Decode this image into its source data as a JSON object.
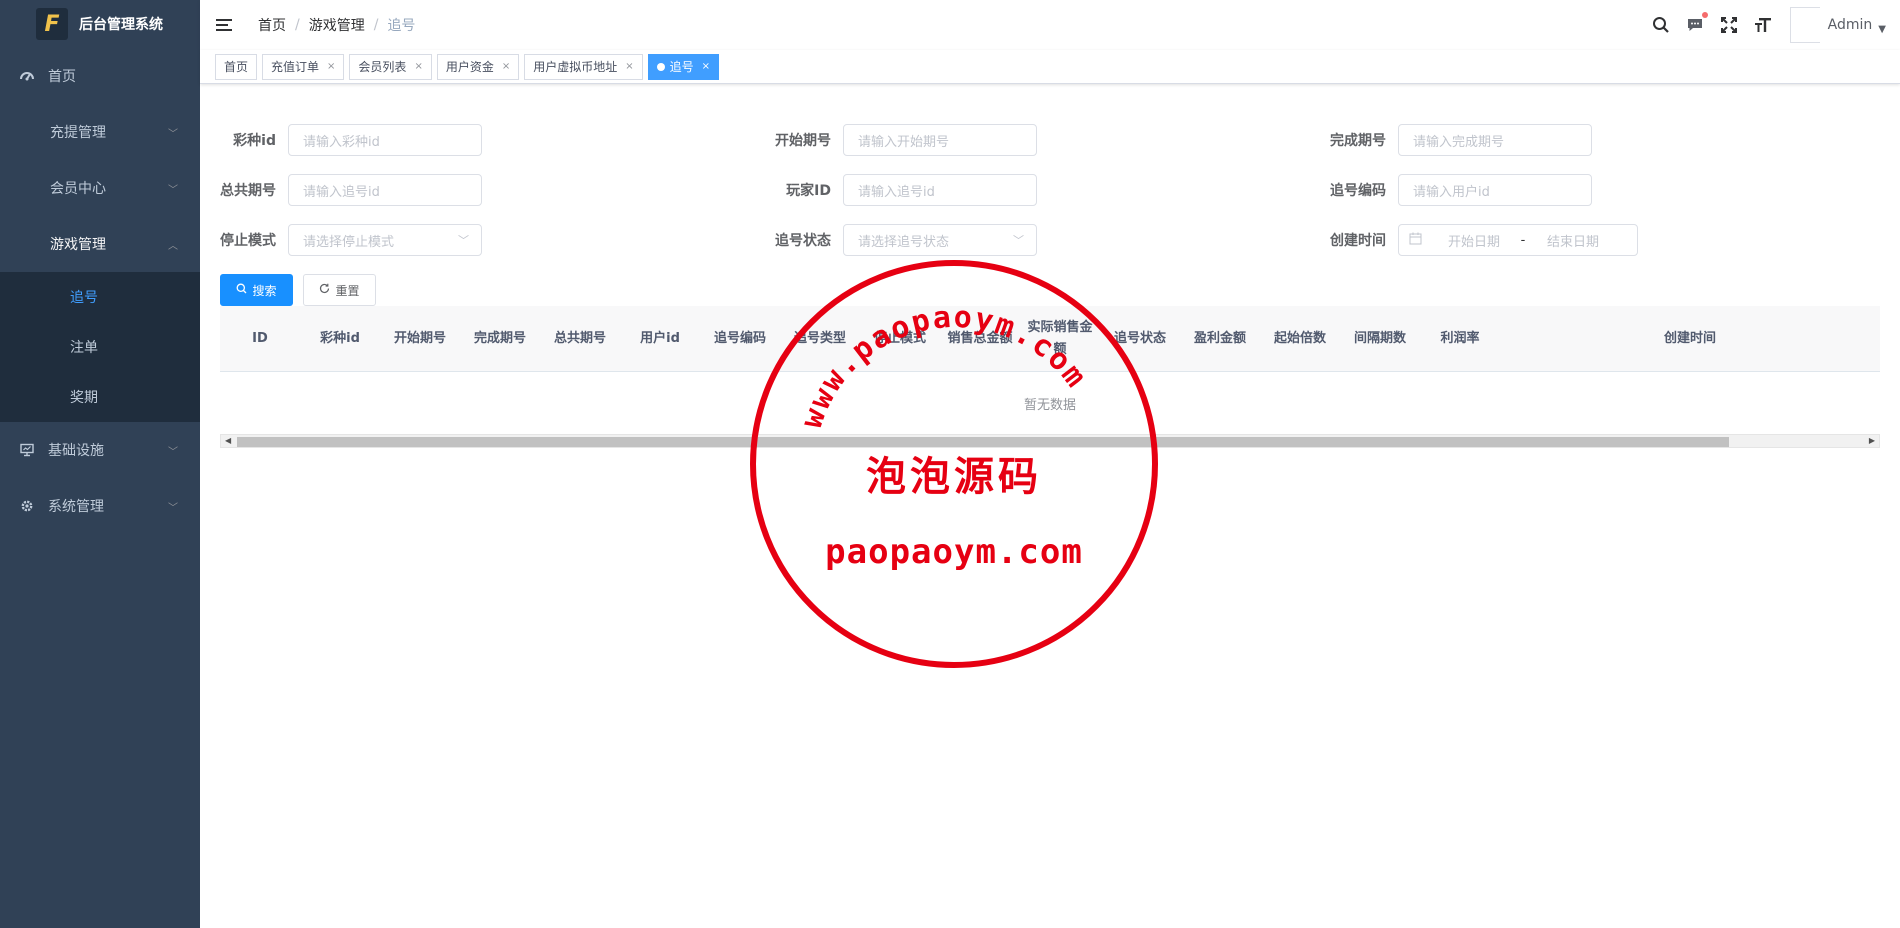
{
  "app": {
    "title": "后台管理系统",
    "logo_text": "F"
  },
  "sidebar": {
    "items": [
      {
        "label": "首页",
        "icon": "dashboard-icon"
      },
      {
        "label": "充提管理",
        "icon": ""
      },
      {
        "label": "会员中心",
        "icon": ""
      },
      {
        "label": "游戏管理",
        "icon": "",
        "open": true,
        "children": [
          {
            "label": "追号",
            "active": true
          },
          {
            "label": "注单"
          },
          {
            "label": "奖期"
          }
        ]
      },
      {
        "label": "基础设施",
        "icon": "monitor-icon"
      },
      {
        "label": "系统管理",
        "icon": "gear-icon"
      }
    ]
  },
  "navbar": {
    "breadcrumb": [
      "首页",
      "游戏管理",
      "追号"
    ],
    "user": "Admin"
  },
  "tags": [
    {
      "label": "首页",
      "closable": false
    },
    {
      "label": "充值订单",
      "closable": true
    },
    {
      "label": "会员列表",
      "closable": true
    },
    {
      "label": "用户资金",
      "closable": true
    },
    {
      "label": "用户虚拟币地址",
      "closable": true
    },
    {
      "label": "追号",
      "closable": true,
      "active": true
    }
  ],
  "form": {
    "fields": [
      {
        "label": "彩种id",
        "placeholder": "请输入彩种id"
      },
      {
        "label": "开始期号",
        "placeholder": "请输入开始期号"
      },
      {
        "label": "完成期号",
        "placeholder": "请输入完成期号"
      },
      {
        "label": "总共期号",
        "placeholder": "请输入追号id"
      },
      {
        "label": "玩家ID",
        "placeholder": "请输入追号id"
      },
      {
        "label": "追号编码",
        "placeholder": "请输入用户id"
      },
      {
        "label": "停止模式",
        "placeholder": "请选择停止模式"
      },
      {
        "label": "追号状态",
        "placeholder": "请选择追号状态"
      },
      {
        "label": "创建时间",
        "start_placeholder": "开始日期",
        "separator": "-",
        "end_placeholder": "结束日期"
      }
    ],
    "search_label": "搜索",
    "reset_label": "重置"
  },
  "table": {
    "columns": [
      "ID",
      "彩种id",
      "开始期号",
      "完成期号",
      "总共期号",
      "用户id",
      "追号编码",
      "追号类型",
      "停止模式",
      "销售总金额",
      "实际销售金额",
      "追号状态",
      "盈利金额",
      "起始倍数",
      "间隔期数",
      "利润率",
      "创建时间"
    ],
    "empty_text": "暂无数据"
  },
  "watermark": {
    "arc_text": "www.paopaoym.com",
    "cn": "泡泡源码",
    "url": "paopaoym.com"
  },
  "colors": {
    "sidebar_bg": "#304156",
    "submenu_bg": "#1f2d3d",
    "primary": "#1890ff",
    "active_link": "#409eff",
    "stamp_red": "#e60012"
  }
}
